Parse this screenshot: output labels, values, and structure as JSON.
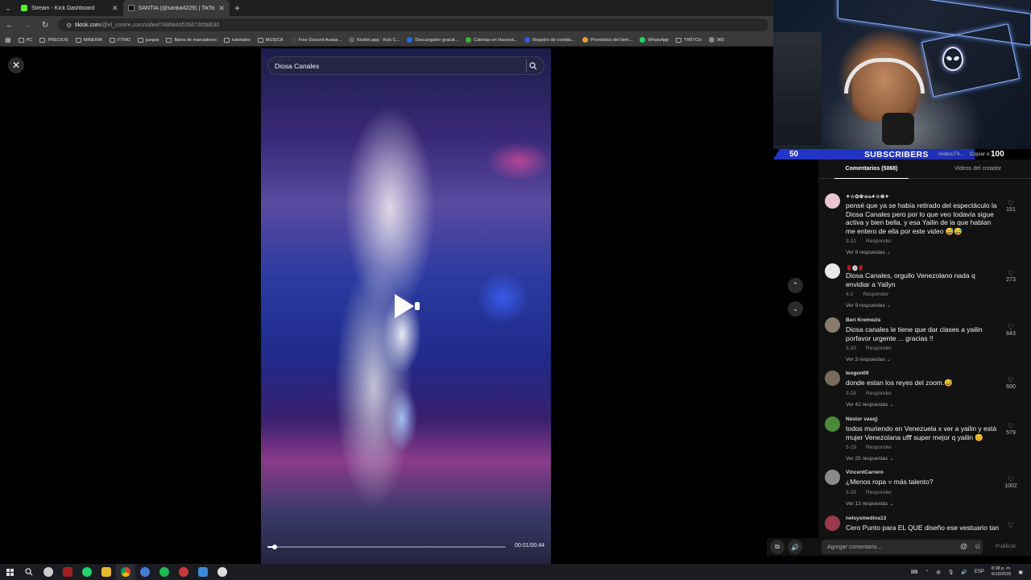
{
  "browser": {
    "tabs": [
      {
        "title": "Stream - Kick Dashboard",
        "color": "#53fc18",
        "active": false
      },
      {
        "title": "SANTIA (@santia4229) | TikTok",
        "color": "#ffffff",
        "active": true
      }
    ],
    "url_host": "tiktok.com",
    "url_path": "/@el_contre.com/video/7486843535673658630",
    "bookmarks": [
      "PC",
      "PRECIOS",
      "MINERIA",
      "FTWD",
      "juegos",
      "Barra de marcadores",
      "tutoriales",
      "MUSICA",
      "Free Discord Avatar...",
      "Kicklet.app - Kick C...",
      "Descargador gratuit...",
      "Calorías en Hacend...",
      "Registro de comida...",
      "Pronóstico del tiem...",
      "WhatsApp",
      "TWITCH",
      "960"
    ]
  },
  "video": {
    "search_text": "Diosa Canales",
    "time": "00:01/00:44",
    "progress": 0.03
  },
  "stream_overlay": {
    "left_count": "50",
    "label": "SUBSCRIBERS",
    "mid_text": "/video/74...",
    "copy_text": "Copiar e",
    "right_count": "100"
  },
  "comments_panel": {
    "tab_comments": "Comentarios (5068)",
    "tab_creator": "Videos del creador",
    "reply_label": "Responder",
    "items": [
      {
        "user": "✦☆✿❀☆̶s̶✦☆❀✦",
        "text": "pensé que ya se había retirado del espectáculo la Diosa Canales pero por lo que veo todavía sigue activa y bien bella. y esa Yailin de la que hablan me entero de ella por este video 😅😅",
        "date": "3-31",
        "replies": "Ver 9 respuestas",
        "likes": "151",
        "avatar": "#e9c6d0"
      },
      {
        "user": "🌹🅧🌹",
        "text": "Diosa Canales, orgullo Venezolano nada q envidiar a Yailyn",
        "date": "4-2",
        "replies": "Ver 9 respuestas",
        "likes": "273",
        "avatar": "#e8e8e8"
      },
      {
        "user": "Beri Kremezis",
        "text": "Diosa canales le tiene que dar clases a yailin porfavor urgente ... gracias !!",
        "date": "3-30",
        "replies": "Ver 3 respuestas",
        "likes": "643",
        "avatar": "#8a7a6a"
      },
      {
        "user": "leogon09",
        "text": "donde estan los reyes del zoom.😅",
        "date": "3-28",
        "replies": "Ver 42 respuestas",
        "likes": "600",
        "avatar": "#7a6a5a"
      },
      {
        "user": "Néstor vasq}",
        "text": "todos muriendo en Venezuela x ver a yailin y está mujer Venezolana ufff super mejor q yailin 😊",
        "date": "3-29",
        "replies": "Ver 25 respuestas",
        "likes": "579",
        "avatar": "#4a8a3a"
      },
      {
        "user": "VincentCarrero",
        "text": "¿Menos ropa = más talento?",
        "date": "3-29",
        "replies": "Ver 13 respuestas",
        "likes": "1002",
        "avatar": "#8a8a8a"
      },
      {
        "user": "nelsysmedina13",
        "text": "Cero Punto para EL QUE diseño ese vestuario tan",
        "date": "",
        "replies": "",
        "likes": "",
        "avatar": "#9a3a4a"
      }
    ]
  },
  "composer": {
    "placeholder": "Agregar comentario...",
    "publish": "Publicar"
  },
  "taskbar": {
    "lang": "ESP",
    "time": "8:38 p. m.",
    "date": "6/10/2025"
  }
}
